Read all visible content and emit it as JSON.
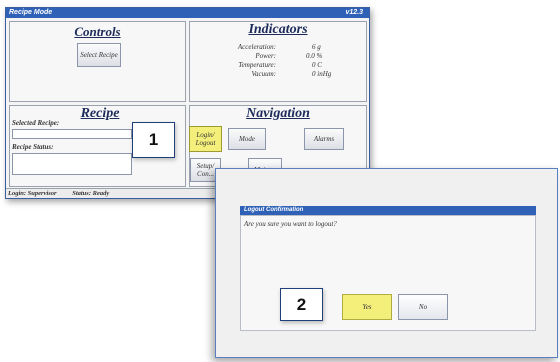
{
  "main_window": {
    "title": "Recipe Mode",
    "version": "v12.3",
    "controls": {
      "header": "Controls",
      "select_recipe": "Select Recipe"
    },
    "indicators": {
      "header": "Indicators",
      "rows": [
        {
          "label": "Acceleration:",
          "value": "6 g"
        },
        {
          "label": "Power:",
          "value": "0.0 %"
        },
        {
          "label": "Temperature:",
          "value": "0 C"
        },
        {
          "label": "Vacuum:",
          "value": "0 inHg"
        }
      ]
    },
    "recipe": {
      "header": "Recipe",
      "selected_label": "Selected Recipe:",
      "status_label": "Recipe Status:"
    },
    "navigation": {
      "header": "Navigation",
      "login_logout": "Login/ Logout",
      "mode": "Mode",
      "alarms": "Alarms",
      "setup": "Setup/ Con...",
      "other": "Maint..."
    },
    "statusbar": {
      "login": "Login: Supervisor",
      "status": "Status: Ready"
    }
  },
  "step_markers": {
    "step1": "1",
    "step2": "2"
  },
  "dialog": {
    "title": "Logout Confirmation",
    "message": "Are you sure you want to logout?",
    "yes": "Yes",
    "no": "No"
  }
}
